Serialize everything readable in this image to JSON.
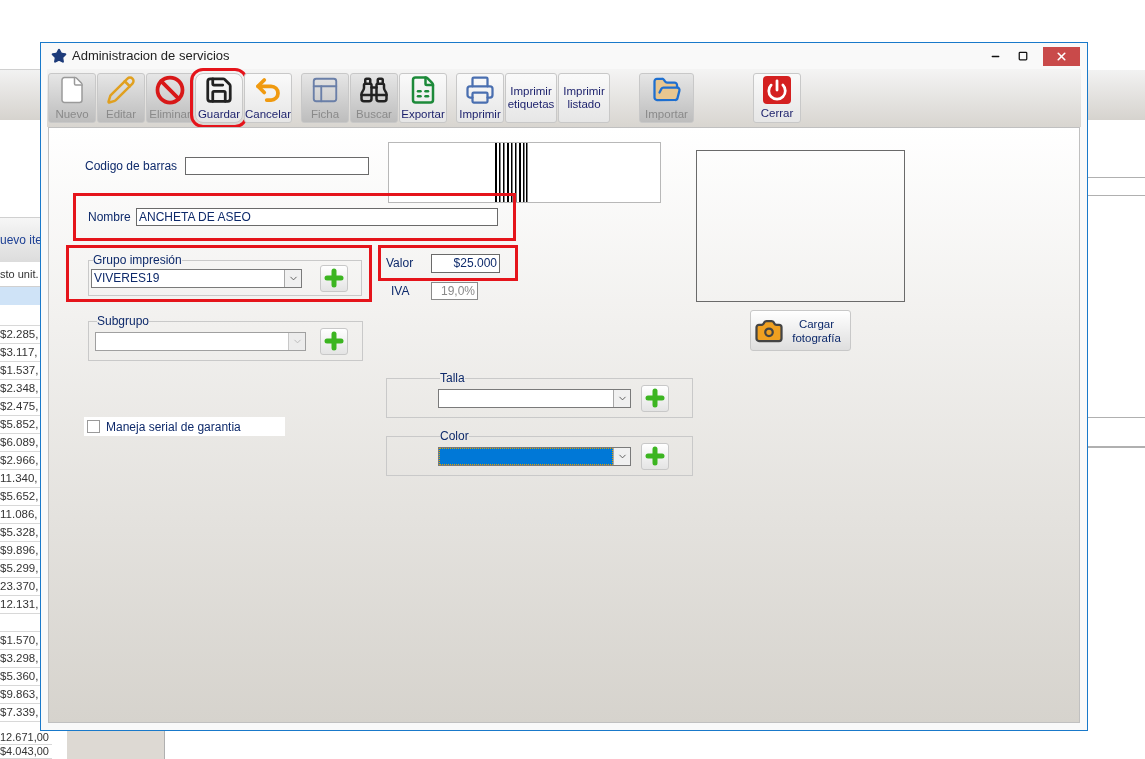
{
  "background_app": {
    "link": "uevo ite",
    "column_header": "sto unit.",
    "cells": [
      "$2.285,",
      "$3.117,",
      "$1.537,",
      "$2.348,",
      "$2.475,",
      "$5.852,",
      "$6.089,",
      "$2.966,",
      "11.340,",
      "$5.652,",
      "11.086,",
      "$5.328,",
      "$9.896,",
      "$5.299,",
      "23.370,",
      "12.131,",
      null,
      "$1.570,",
      "$3.298,",
      "$5.360,",
      "$9.863,",
      "$7.339,"
    ],
    "cells_below": [
      "12.671,00",
      "$4.043,00"
    ]
  },
  "window": {
    "title": "Administracion de servicios"
  },
  "toolbar_groups": [
    {
      "buttons": [
        {
          "label": "Nuevo",
          "kind": "new",
          "enabled": false,
          "highlighted": false
        },
        {
          "label": "Editar",
          "kind": "edit",
          "enabled": false,
          "highlighted": false
        },
        {
          "label": "Eliminar",
          "kind": "delete",
          "enabled": false,
          "highlighted": false
        },
        {
          "label": "Guardar",
          "kind": "save",
          "enabled": true,
          "highlighted": true
        },
        {
          "label": "Cancelar",
          "kind": "cancel",
          "enabled": true,
          "highlighted": false
        }
      ]
    },
    {
      "buttons": [
        {
          "label": "Ficha",
          "kind": "form",
          "enabled": false,
          "highlighted": false
        },
        {
          "label": "Buscar",
          "kind": "search",
          "enabled": false,
          "highlighted": false
        },
        {
          "label": "Exportar",
          "kind": "export",
          "enabled": true,
          "highlighted": false
        }
      ]
    },
    {
      "buttons": [
        {
          "label": "Imprimir",
          "kind": "print",
          "enabled": true,
          "highlighted": false
        },
        {
          "label": "Imprimir etiquetas",
          "kind": "text",
          "enabled": true,
          "highlighted": false
        },
        {
          "label": "Imprimir listado",
          "kind": "text",
          "enabled": true,
          "highlighted": false
        }
      ]
    },
    {
      "buttons": [
        {
          "label": "Importar",
          "kind": "import",
          "enabled": false,
          "highlighted": false
        }
      ]
    },
    {
      "buttons": [
        {
          "label": "Cerrar",
          "kind": "close",
          "enabled": true,
          "highlighted": false
        }
      ]
    }
  ],
  "form": {
    "barcode": {
      "label": "Codigo de barras"
    },
    "nombre": {
      "label": "Nombre",
      "value": "ANCHETA DE ASEO",
      "highlighted": true
    },
    "grupo": {
      "label": "Grupo impresión",
      "value": "VIVERES19",
      "highlighted": true
    },
    "subgrupo": {
      "label": "Subgrupo",
      "enabled": false
    },
    "serial": {
      "label": "Maneja serial de garantia",
      "checked": false
    },
    "valor": {
      "label": "Valor",
      "value": "$25.000",
      "highlighted": true
    },
    "iva": {
      "label": "IVA",
      "value": "19,0%",
      "enabled": false
    },
    "talla": {
      "label": "Talla",
      "focused": false
    },
    "color": {
      "label": "Color",
      "focused": true
    },
    "photo": {
      "button": "Cargar fotografía"
    }
  }
}
